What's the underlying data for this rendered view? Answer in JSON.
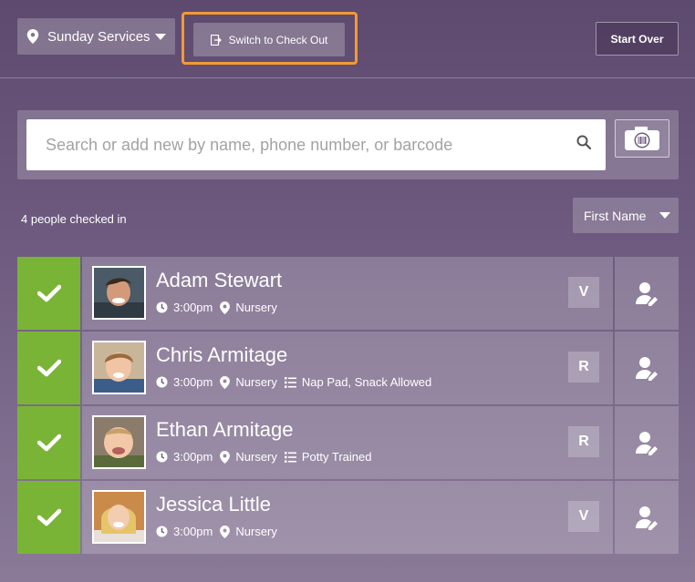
{
  "header": {
    "location_label": "Sunday Services",
    "switch_label": "Switch to Check Out",
    "start_over_label": "Start Over"
  },
  "search": {
    "placeholder": "Search or add new by name, phone number, or barcode"
  },
  "summary": {
    "count_text": "4 people checked in",
    "sort_label": "First Name"
  },
  "people": [
    {
      "name": "Adam Stewart",
      "time": "3:00pm",
      "room": "Nursery",
      "notes": "",
      "badge": "V",
      "checked_in": true
    },
    {
      "name": "Chris Armitage",
      "time": "3:00pm",
      "room": "Nursery",
      "notes": "Nap Pad, Snack Allowed",
      "badge": "R",
      "checked_in": true
    },
    {
      "name": "Ethan Armitage",
      "time": "3:00pm",
      "room": "Nursery",
      "notes": "Potty Trained",
      "badge": "R",
      "checked_in": true
    },
    {
      "name": "Jessica Little",
      "time": "3:00pm",
      "room": "Nursery",
      "notes": "",
      "badge": "V",
      "checked_in": true
    }
  ],
  "colors": {
    "accent_highlight": "#f39a34",
    "checked_green": "#7ab437"
  }
}
